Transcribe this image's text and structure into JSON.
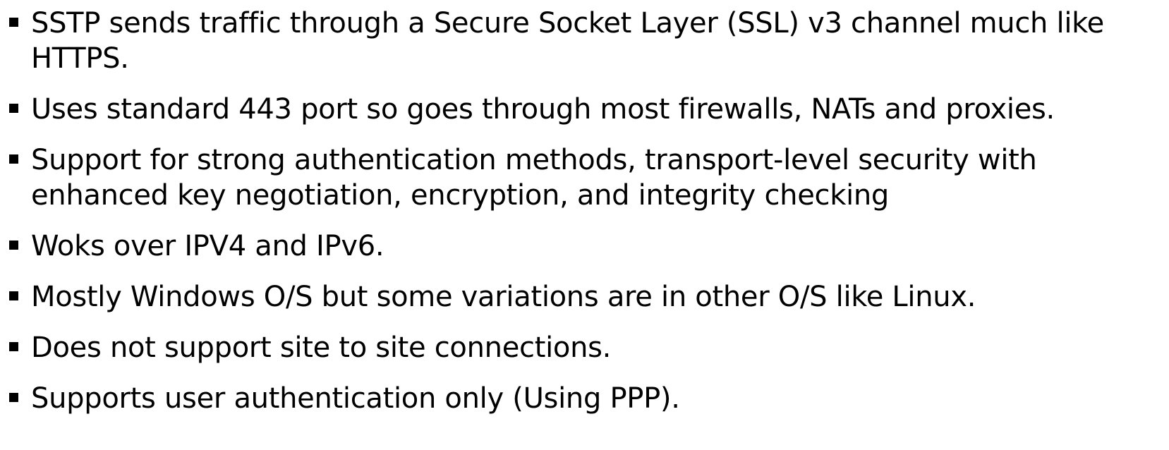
{
  "bullets": [
    {
      "text": "SSTP sends traffic through a Secure Socket Layer (SSL) v3 channel much like\nHTTPS."
    },
    {
      "text": "Uses standard 443 port so goes through most firewalls, NATs and proxies."
    },
    {
      "text": "Support for strong authentication methods, transport-level security with\nenhanced key negotiation, encryption, and integrity checking"
    },
    {
      "text": "Woks over IPV4 and IPv6."
    },
    {
      "text": "Mostly Windows O/S but some variations are in other O/S like Linux."
    },
    {
      "text": "Does not support site to site connections."
    },
    {
      "text": "Supports user authentication only (Using PPP)."
    }
  ]
}
